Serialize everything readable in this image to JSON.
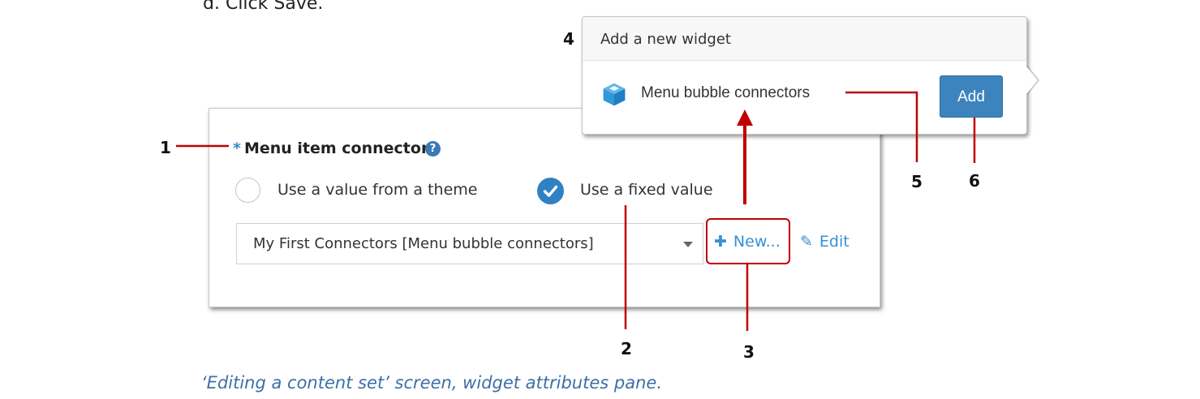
{
  "instruction_step": "d.  Click Save.",
  "field": {
    "required_mark": "*",
    "label": "Menu item connector"
  },
  "options": {
    "theme_label": "Use a value from a theme",
    "fixed_label": "Use a fixed value",
    "selected": "fixed"
  },
  "select": {
    "value": "My First Connectors [Menu bubble connectors]"
  },
  "actions": {
    "new_label": "New...",
    "edit_label": "Edit"
  },
  "popup": {
    "title": "Add a new widget",
    "widget_name": "Menu bubble connectors",
    "add_label": "Add"
  },
  "callout_numbers": [
    "1",
    "2",
    "3",
    "4",
    "5",
    "6"
  ],
  "callout_color": "#c00000",
  "caption": "‘Editing a content set’ screen, widget attributes pane."
}
